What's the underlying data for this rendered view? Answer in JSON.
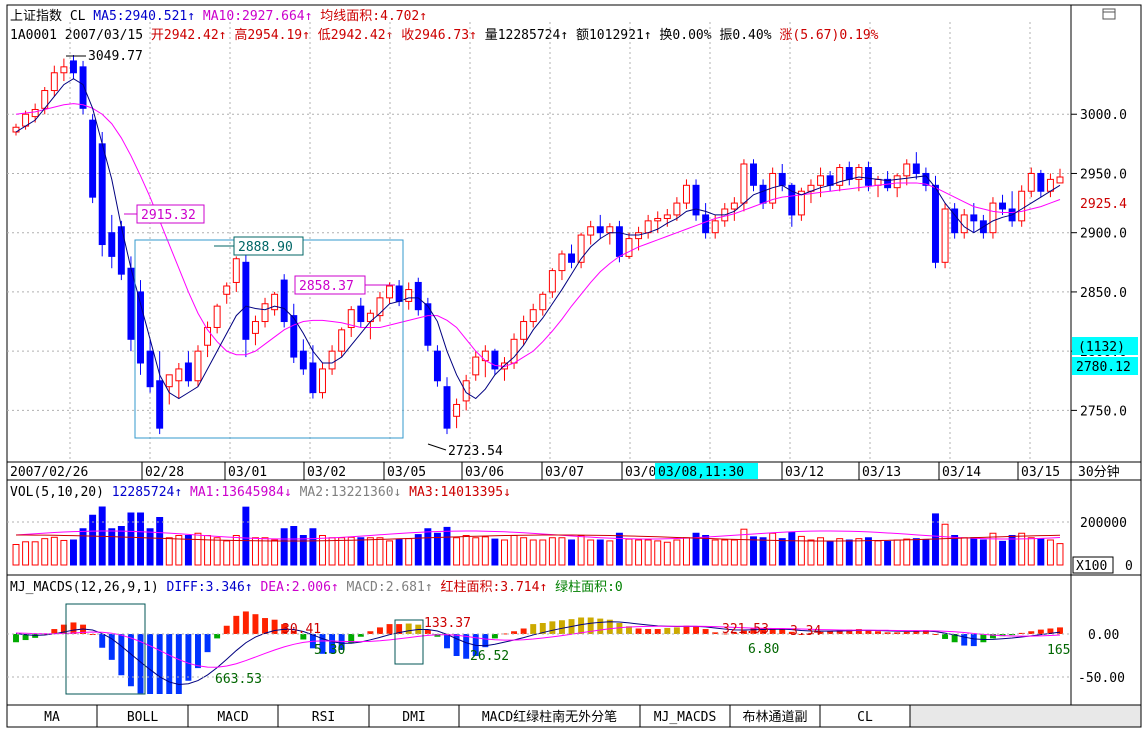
{
  "header": {
    "index_name": "上证指数",
    "line1": [
      {
        "text": "上证指数 CL",
        "color": "#000000"
      },
      {
        "text": "MA5:2940.521↑",
        "color": "#0000cc"
      },
      {
        "text": "MA10:2927.664↑",
        "color": "#cc00cc"
      },
      {
        "text": "均线面积:4.702↑",
        "color": "#cc0000"
      }
    ],
    "line2": [
      {
        "text": "1A0001 2007/03/15",
        "color": "#000000"
      },
      {
        "text": "开2942.42↑",
        "color": "#cc0000"
      },
      {
        "text": "高2954.19↑",
        "color": "#cc0000"
      },
      {
        "text": "低2942.42↑",
        "color": "#cc0000"
      },
      {
        "text": "收2946.73↑",
        "color": "#cc0000"
      },
      {
        "text": "量12285724↑",
        "color": "#000000"
      },
      {
        "text": "额1012921↑",
        "color": "#000000"
      },
      {
        "text": "换0.00%",
        "color": "#000000"
      },
      {
        "text": "振0.40%",
        "color": "#000000"
      },
      {
        "text": "涨(5.67)0.19%",
        "color": "#cc0000"
      }
    ],
    "corner_icon": "window-restore-icon"
  },
  "price_axis": {
    "ticks": [
      "3000.0",
      "2950.0",
      "2900.0",
      "2850.0",
      "2800.0",
      "2750.0"
    ],
    "tick_values": [
      3000,
      2950,
      2900,
      2850,
      2800,
      2750
    ],
    "current_price_label": "2925.4",
    "cursor_count_label": "(1132)",
    "cursor_price_label": "2780.12"
  },
  "date_axis": {
    "labels": [
      "2007/02/26",
      "02/28",
      "03/01",
      "03/02",
      "03/05",
      "03/06",
      "03/07",
      "03/0",
      "03/12",
      "03/13",
      "03/14",
      "03/15"
    ],
    "cursor_label": "03/08,11:30",
    "period_label": "30分钟"
  },
  "annotations": {
    "high": "3049.77",
    "low": "2723.54",
    "ma_mark": "2915.32",
    "box_high": "2888.90",
    "box_mark": "2858.37"
  },
  "volume_panel": {
    "header": [
      {
        "text": "VOL(5,10,20)",
        "color": "#000000"
      },
      {
        "text": "12285724↑",
        "color": "#0000cc"
      },
      {
        "text": "MA1:13645984↓",
        "color": "#cc00cc"
      },
      {
        "text": "MA2:13221360↓",
        "color": "#808080"
      },
      {
        "text": "MA3:14013395↓",
        "color": "#cc0000"
      }
    ],
    "axis_label": "200000",
    "unit_label": "X100",
    "zero_label": "0"
  },
  "macd_panel": {
    "header": [
      {
        "text": "MJ_MACDS(12,26,9,1)",
        "color": "#000000"
      },
      {
        "text": "DIFF:3.346↑",
        "color": "#0000cc"
      },
      {
        "text": "DEA:2.006↑",
        "color": "#cc00cc"
      },
      {
        "text": "MACD:2.681↑",
        "color": "#808080"
      },
      {
        "text": "红柱面积:3.714↑",
        "color": "#cc0000"
      },
      {
        "text": "绿柱面积:0",
        "color": "#008000"
      }
    ],
    "axis_labels": [
      "0.00",
      "-50.00"
    ],
    "annotations": [
      "30.41",
      "133.37",
      "5.30",
      "26.52",
      "663.53",
      "321.53",
      "3.34",
      "6.80",
      "165"
    ]
  },
  "tabs": [
    "MA",
    "BOLL",
    "MACD",
    "RSI",
    "DMI",
    "MACD红绿柱南无外分笔",
    "MJ_MACDS",
    "布林通道副",
    "CL"
  ],
  "colors": {
    "up": "#ff0000",
    "down": "#0000ff",
    "ma5": "#000080",
    "ma10": "#ff00ff",
    "grid": "#b0b0b0",
    "macd_green": "#00aa00",
    "macd_blue": "#0033ff",
    "macd_red": "#ff2200",
    "macd_yellow": "#ccaa00",
    "highlight": "#00ffff"
  },
  "chart_data": {
    "type": "candlestick",
    "period": "30分钟",
    "candles": [
      [
        2985,
        2992,
        2982,
        2989
      ],
      [
        2990,
        3003,
        2987,
        3000
      ],
      [
        2998,
        3009,
        2993,
        3004
      ],
      [
        3005,
        3023,
        3000,
        3020
      ],
      [
        3020,
        3041,
        3015,
        3035
      ],
      [
        3035,
        3047,
        3028,
        3040
      ],
      [
        3045,
        3050,
        3030,
        3035
      ],
      [
        3040,
        3045,
        3000,
        3005
      ],
      [
        2995,
        3000,
        2925,
        2930
      ],
      [
        2975,
        2985,
        2880,
        2890
      ],
      [
        2900,
        2915,
        2870,
        2880
      ],
      [
        2905,
        2910,
        2860,
        2865
      ],
      [
        2870,
        2880,
        2800,
        2810
      ],
      [
        2850,
        2860,
        2780,
        2790
      ],
      [
        2800,
        2810,
        2765,
        2770
      ],
      [
        2775,
        2800,
        2730,
        2735
      ],
      [
        2770,
        2780,
        2755,
        2780
      ],
      [
        2775,
        2790,
        2760,
        2785
      ],
      [
        2790,
        2800,
        2770,
        2775
      ],
      [
        2775,
        2805,
        2770,
        2800
      ],
      [
        2805,
        2825,
        2795,
        2820
      ],
      [
        2820,
        2840,
        2815,
        2838
      ],
      [
        2848,
        2858,
        2840,
        2855
      ],
      [
        2858,
        2880,
        2850,
        2878
      ],
      [
        2875,
        2888,
        2795,
        2810
      ],
      [
        2815,
        2830,
        2805,
        2825
      ],
      [
        2825,
        2845,
        2820,
        2840
      ],
      [
        2835,
        2850,
        2830,
        2848
      ],
      [
        2860,
        2865,
        2820,
        2825
      ],
      [
        2830,
        2840,
        2790,
        2795
      ],
      [
        2800,
        2810,
        2780,
        2785
      ],
      [
        2790,
        2805,
        2760,
        2765
      ],
      [
        2765,
        2790,
        2760,
        2785
      ],
      [
        2785,
        2805,
        2780,
        2800
      ],
      [
        2800,
        2820,
        2795,
        2818
      ],
      [
        2820,
        2838,
        2812,
        2835
      ],
      [
        2838,
        2845,
        2820,
        2825
      ],
      [
        2825,
        2835,
        2810,
        2832
      ],
      [
        2830,
        2850,
        2825,
        2845
      ],
      [
        2845,
        2858,
        2840,
        2855
      ],
      [
        2855,
        2860,
        2838,
        2842
      ],
      [
        2842,
        2858,
        2835,
        2852
      ],
      [
        2858,
        2862,
        2830,
        2835
      ],
      [
        2840,
        2845,
        2800,
        2805
      ],
      [
        2800,
        2805,
        2770,
        2775
      ],
      [
        2770,
        2778,
        2730,
        2735
      ],
      [
        2745,
        2760,
        2735,
        2755
      ],
      [
        2758,
        2780,
        2750,
        2775
      ],
      [
        2780,
        2800,
        2775,
        2795
      ],
      [
        2792,
        2805,
        2778,
        2800
      ],
      [
        2800,
        2802,
        2780,
        2785
      ],
      [
        2785,
        2795,
        2775,
        2790
      ],
      [
        2790,
        2815,
        2785,
        2810
      ],
      [
        2810,
        2830,
        2805,
        2825
      ],
      [
        2825,
        2840,
        2820,
        2835
      ],
      [
        2835,
        2850,
        2830,
        2848
      ],
      [
        2850,
        2870,
        2845,
        2868
      ],
      [
        2868,
        2885,
        2860,
        2882
      ],
      [
        2882,
        2890,
        2870,
        2875
      ],
      [
        2875,
        2900,
        2870,
        2898
      ],
      [
        2898,
        2910,
        2890,
        2905
      ],
      [
        2905,
        2915,
        2895,
        2900
      ],
      [
        2900,
        2908,
        2890,
        2905
      ],
      [
        2905,
        2910,
        2875,
        2880
      ],
      [
        2880,
        2900,
        2878,
        2895
      ],
      [
        2895,
        2905,
        2885,
        2900
      ],
      [
        2900,
        2915,
        2895,
        2910
      ],
      [
        2910,
        2918,
        2900,
        2912
      ],
      [
        2912,
        2920,
        2905,
        2915
      ],
      [
        2915,
        2930,
        2910,
        2925
      ],
      [
        2925,
        2945,
        2920,
        2940
      ],
      [
        2940,
        2945,
        2910,
        2915
      ],
      [
        2915,
        2925,
        2895,
        2900
      ],
      [
        2900,
        2915,
        2895,
        2910
      ],
      [
        2910,
        2925,
        2905,
        2920
      ],
      [
        2920,
        2930,
        2910,
        2925
      ],
      [
        2925,
        2962,
        2918,
        2958
      ],
      [
        2958,
        2962,
        2935,
        2940
      ],
      [
        2940,
        2945,
        2920,
        2925
      ],
      [
        2925,
        2955,
        2920,
        2950
      ],
      [
        2950,
        2958,
        2935,
        2940
      ],
      [
        2940,
        2942,
        2905,
        2915
      ],
      [
        2915,
        2938,
        2910,
        2935
      ],
      [
        2935,
        2945,
        2925,
        2940
      ],
      [
        2940,
        2955,
        2930,
        2948
      ],
      [
        2948,
        2952,
        2935,
        2940
      ],
      [
        2940,
        2958,
        2935,
        2955
      ],
      [
        2955,
        2960,
        2940,
        2945
      ],
      [
        2945,
        2958,
        2935,
        2955
      ],
      [
        2955,
        2960,
        2935,
        2940
      ],
      [
        2940,
        2948,
        2930,
        2945
      ],
      [
        2945,
        2952,
        2935,
        2938
      ],
      [
        2938,
        2950,
        2930,
        2948
      ],
      [
        2948,
        2962,
        2940,
        2958
      ],
      [
        2958,
        2968,
        2945,
        2950
      ],
      [
        2950,
        2955,
        2935,
        2940
      ],
      [
        2940,
        2948,
        2870,
        2875
      ],
      [
        2875,
        2925,
        2870,
        2920
      ],
      [
        2920,
        2925,
        2895,
        2900
      ],
      [
        2900,
        2920,
        2895,
        2915
      ],
      [
        2915,
        2925,
        2900,
        2910
      ],
      [
        2910,
        2915,
        2895,
        2900
      ],
      [
        2900,
        2930,
        2895,
        2925
      ],
      [
        2925,
        2932,
        2915,
        2920
      ],
      [
        2920,
        2935,
        2905,
        2910
      ],
      [
        2910,
        2940,
        2905,
        2935
      ],
      [
        2935,
        2955,
        2930,
        2950
      ],
      [
        2950,
        2953,
        2930,
        2935
      ],
      [
        2935,
        2950,
        2930,
        2945
      ],
      [
        2942,
        2954,
        2942,
        2947
      ]
    ],
    "ma5": [
      2985,
      2990,
      2995,
      3005,
      3015,
      3025,
      3030,
      3025,
      3005,
      2975,
      2945,
      2905,
      2870,
      2840,
      2810,
      2780,
      2765,
      2760,
      2765,
      2770,
      2785,
      2800,
      2815,
      2830,
      2838,
      2836,
      2835,
      2838,
      2836,
      2828,
      2815,
      2800,
      2790,
      2790,
      2795,
      2805,
      2815,
      2825,
      2832,
      2840,
      2842,
      2845,
      2845,
      2838,
      2825,
      2800,
      2780,
      2765,
      2760,
      2768,
      2780,
      2788,
      2795,
      2805,
      2818,
      2828,
      2840,
      2852,
      2865,
      2878,
      2888,
      2895,
      2900,
      2900,
      2898,
      2898,
      2900,
      2903,
      2908,
      2912,
      2918,
      2920,
      2918,
      2915,
      2915,
      2918,
      2925,
      2932,
      2935,
      2938,
      2940,
      2935,
      2932,
      2935,
      2938,
      2940,
      2943,
      2945,
      2947,
      2946,
      2945,
      2944,
      2945,
      2946,
      2947,
      2948,
      2938,
      2925,
      2915,
      2905,
      2900,
      2905,
      2910,
      2913,
      2915,
      2920,
      2925,
      2930,
      2935,
      2940
    ],
    "ma10": [
      3000,
      3001,
      3002,
      3004,
      3006,
      3008,
      3009,
      3008,
      3005,
      3000,
      2992,
      2980,
      2965,
      2948,
      2930,
      2910,
      2890,
      2870,
      2850,
      2832,
      2818,
      2808,
      2800,
      2797,
      2797,
      2800,
      2806,
      2812,
      2818,
      2822,
      2825,
      2826,
      2826,
      2825,
      2824,
      2822,
      2820,
      2820,
      2820,
      2822,
      2824,
      2826,
      2828,
      2830,
      2830,
      2826,
      2820,
      2810,
      2800,
      2792,
      2788,
      2787,
      2790,
      2795,
      2800,
      2808,
      2817,
      2827,
      2838,
      2848,
      2858,
      2867,
      2874,
      2880,
      2884,
      2888,
      2891,
      2894,
      2897,
      2900,
      2903,
      2906,
      2909,
      2912,
      2914,
      2916,
      2919,
      2922,
      2925,
      2928,
      2930,
      2931,
      2932,
      2933,
      2934,
      2935,
      2936,
      2937,
      2938,
      2939,
      2940,
      2941,
      2942,
      2942,
      2942,
      2941,
      2938,
      2934,
      2930,
      2926,
      2922,
      2920,
      2918,
      2917,
      2917,
      2918,
      2920,
      2922,
      2925,
      2928
    ]
  }
}
